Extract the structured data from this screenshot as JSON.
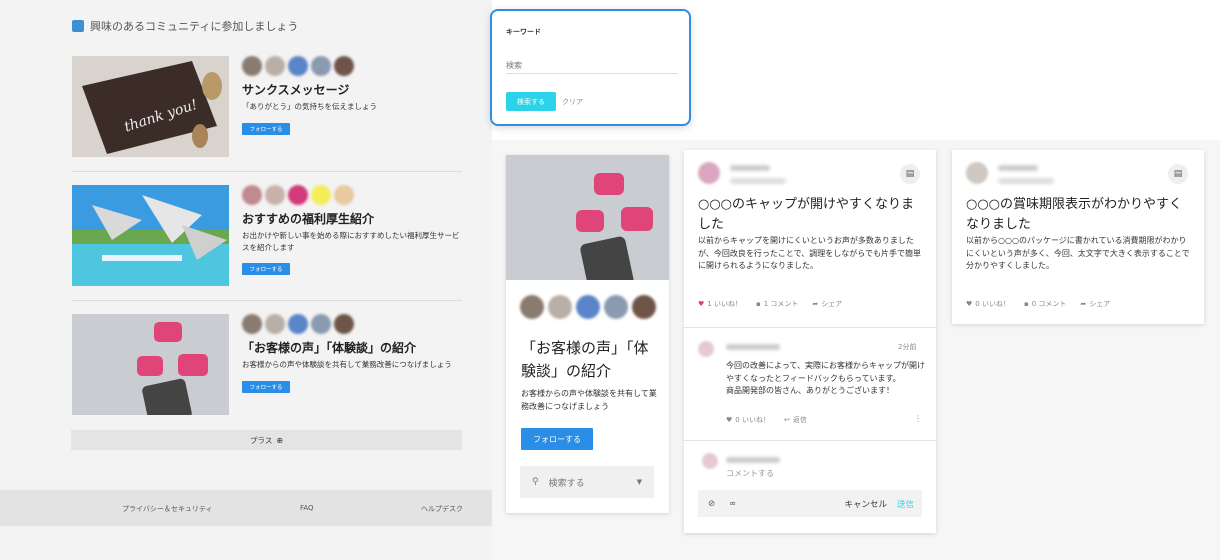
{
  "left": {
    "heading": "興味のあるコミュニティに参加しましょう",
    "communities": [
      {
        "title": "サンクスメッセージ",
        "desc": "「ありがとう」の気持ちを伝えましょう",
        "follow": "フォローする"
      },
      {
        "title": "おすすめの福利厚生紹介",
        "desc": "お出かけや新しい事を始める際におすすめしたい福利厚生サービスを紹介します",
        "follow": "フォローする"
      },
      {
        "title": "「お客様の声」「体験談」の紹介",
        "desc": "お客様からの声や体験談を共有して業務改善につなげましょう",
        "follow": "フォローする"
      }
    ],
    "thumb_text": "thank you!",
    "more": "プラス",
    "footer": {
      "privacy": "プライバシー＆セキュリティ",
      "faq": "FAQ",
      "help": "ヘルプデスク"
    }
  },
  "search": {
    "label": "キーワード",
    "placeholder": "検索",
    "submit": "検索する",
    "clear": "クリア"
  },
  "community_card": {
    "title": "「お客様の声」「体験談」の紹介",
    "desc": "お客様からの声や体験談を共有して業務改善につなげましょう",
    "follow": "フォローする",
    "search_placeholder": "検索する"
  },
  "post1": {
    "title": "○○○のキャップが開けやすくなりました",
    "body": "以前からキャップを開けにくいというお声が多数ありましたが、今回改良を行ったことで、調理をしながらでも片手で簡単に開けられるようになりました。",
    "like": "1 いいね！",
    "comment": "1 コメント",
    "share": "シェア",
    "reply": {
      "time": "2分前",
      "text": "今回の改善によって、実際にお客様からキャップが開けやすくなったとフィードバックもらっています。\n商品開発部の皆さん、ありがとうございます！",
      "like": "0 いいね！",
      "reply_label": "返信"
    },
    "comment_placeholder": "コメントする",
    "cancel": "キャンセル",
    "send": "送信"
  },
  "post2": {
    "title": "○○○の賞味期限表示がわかりやすくなりました",
    "body": "以前から○○○のパッケージに書かれている消費期限がわかりにくいという声が多く、今回、太文字で大きく表示することで分かりやすくしました。",
    "like": "0 いいね！",
    "comment": "0 コメント",
    "share": "シェア"
  },
  "colors": {
    "accent": "#2b8ee6",
    "search_btn": "#2bd2e8",
    "like_heart": "#e0455a"
  }
}
